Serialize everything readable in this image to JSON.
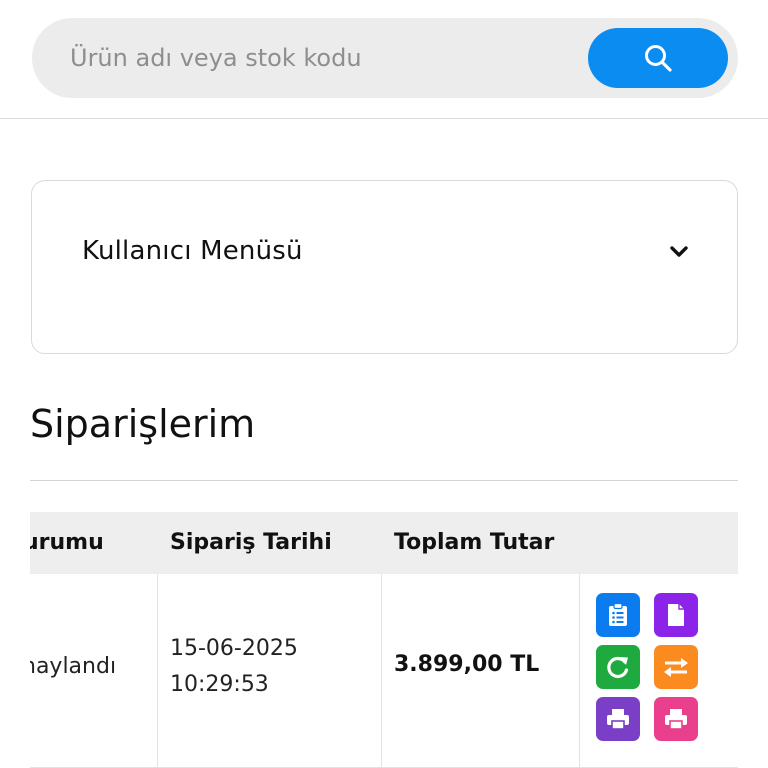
{
  "search": {
    "placeholder": "Ürün adı veya stok kodu",
    "button_icon": "search-icon",
    "accent_color": "#0a8cf0"
  },
  "user_menu": {
    "title": "Kullanıcı Menüsü",
    "toggle_icon": "chevron-down-icon"
  },
  "orders": {
    "title": "Siparişlerim",
    "columns": [
      "urumu",
      "Sipariş Tarihi",
      "Toplam Tutar",
      ""
    ],
    "rows": [
      {
        "status": "naylandı",
        "date": "15-06-2025",
        "time": "10:29:53",
        "total": "3.899,00 TL",
        "actions": [
          {
            "icon": "clipboard-list-icon",
            "color": "#0a7cf0"
          },
          {
            "icon": "document-icon",
            "color": "#8b24e8"
          },
          {
            "icon": "refresh-icon",
            "color": "#1faa3f"
          },
          {
            "icon": "exchange-arrows-icon",
            "color": "#fb8b1e"
          },
          {
            "icon": "print-icon",
            "color": "#7a3fc6"
          },
          {
            "icon": "print-icon",
            "color": "#ea3f8d"
          }
        ]
      }
    ]
  }
}
